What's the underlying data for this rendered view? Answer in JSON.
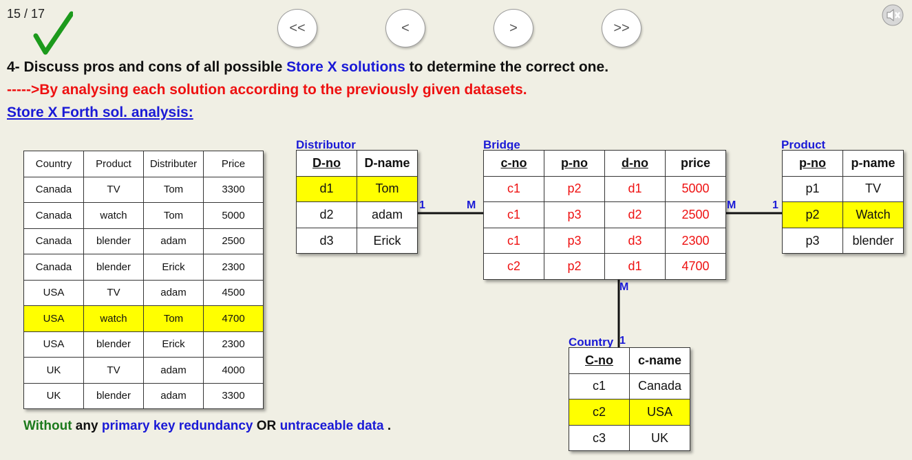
{
  "counter": "15 / 17",
  "nav": {
    "first": "<<",
    "prev": "<",
    "next": ">",
    "last": ">>"
  },
  "heading": {
    "part1": "4- Discuss pros and cons of all possible ",
    "highlight": "Store X solutions",
    "part2": " to determine the correct one."
  },
  "subheading": "----->By analysing each solution according to the previously given datasets.",
  "section_title": "Store X Forth sol. analysis:",
  "main_table": {
    "headers": [
      "Country",
      "Product",
      "Distributer",
      "Price"
    ],
    "rows": [
      [
        "Canada",
        "TV",
        "Tom",
        "3300"
      ],
      [
        "Canada",
        "watch",
        "Tom",
        "5000"
      ],
      [
        "Canada",
        "blender",
        "adam",
        "2500"
      ],
      [
        "Canada",
        "blender",
        "Erick",
        "2300"
      ],
      [
        "USA",
        "TV",
        "adam",
        "4500"
      ],
      [
        "USA",
        "watch",
        "Tom",
        "4700"
      ],
      [
        "USA",
        "blender",
        "Erick",
        "2300"
      ],
      [
        "UK",
        "TV",
        "adam",
        "4000"
      ],
      [
        "UK",
        "blender",
        "adam",
        "3300"
      ]
    ]
  },
  "distributor": {
    "label": "Distributor",
    "headers": [
      "D-no",
      "D-name"
    ],
    "rows": [
      [
        "d1",
        "Tom"
      ],
      [
        "d2",
        "adam"
      ],
      [
        "d3",
        "Erick"
      ]
    ]
  },
  "bridge": {
    "label": "Bridge",
    "headers": [
      "c-no",
      "p-no",
      "d-no",
      "price"
    ],
    "rows": [
      [
        "c1",
        "p2",
        "d1",
        "5000"
      ],
      [
        "c1",
        "p3",
        "d2",
        "2500"
      ],
      [
        "c1",
        "p3",
        "d3",
        "2300"
      ],
      [
        "c2",
        "p2",
        "d1",
        "4700"
      ]
    ]
  },
  "product": {
    "label": "Product",
    "headers": [
      "p-no",
      "p-name"
    ],
    "rows": [
      [
        "p1",
        "TV"
      ],
      [
        "p2",
        "Watch"
      ],
      [
        "p3",
        "blender"
      ]
    ]
  },
  "country": {
    "label": "Country",
    "headers": [
      "C-no",
      "c-name"
    ],
    "rows": [
      [
        "c1",
        "Canada"
      ],
      [
        "c2",
        "USA"
      ],
      [
        "c3",
        "UK"
      ]
    ]
  },
  "cardinality": {
    "dist_side": "1",
    "bridge_left": "M",
    "bridge_right": "M",
    "product_side": "1",
    "bridge_bottom": "M",
    "country_side": "1"
  },
  "footer": {
    "without": "Without",
    "any": " any ",
    "pk_redundancy": "primary key redundancy",
    "or": " OR ",
    "untraceable": "untraceable data",
    "end": " ."
  },
  "colors": {
    "highlight": "#ffff00",
    "blue": "#1a1ad6",
    "red": "#ee1111",
    "green": "#1c7a1c"
  }
}
